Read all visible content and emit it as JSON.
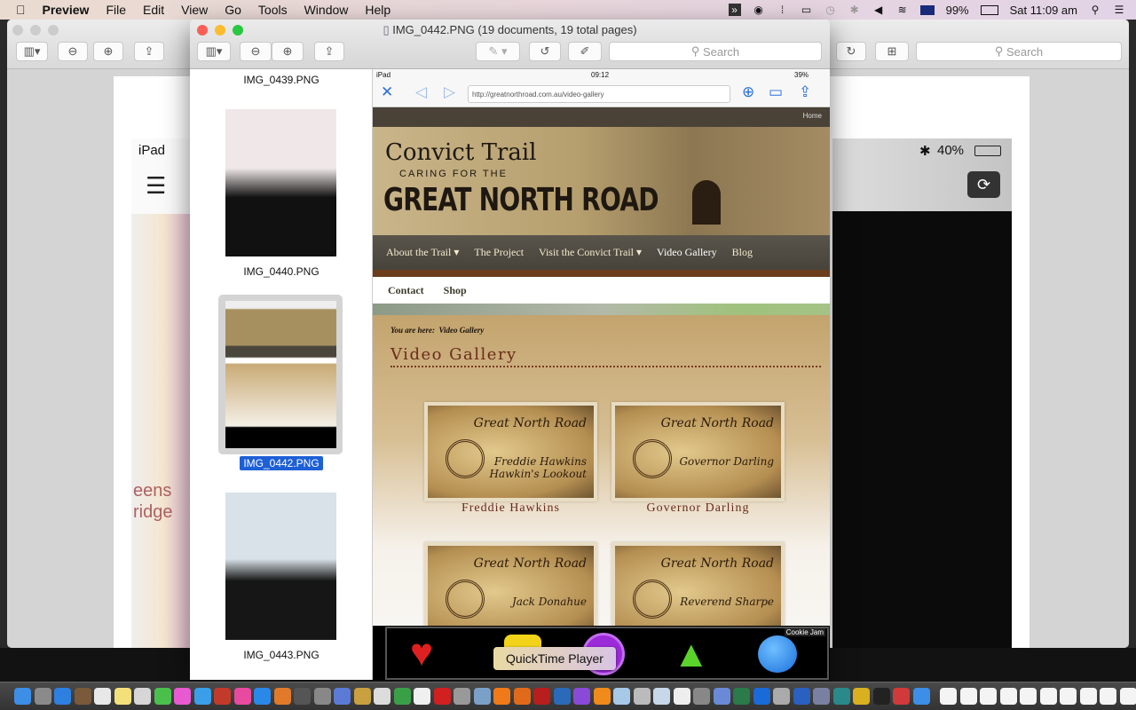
{
  "menubar": {
    "app": "Preview",
    "items": [
      "File",
      "Edit",
      "View",
      "Go",
      "Tools",
      "Window",
      "Help"
    ],
    "battery": "99%",
    "clock": "Sat 11:09 am"
  },
  "background_window": {
    "search_placeholder": "Search",
    "ipad_label": "iPad",
    "battery": "40%",
    "partial_text": "eens\nridge"
  },
  "window": {
    "title": "IMG_0442.PNG (19 documents, 19 total pages)",
    "search_placeholder": "Search",
    "sidebar": [
      {
        "label": "IMG_0439.PNG",
        "selected": false
      },
      {
        "label": "IMG_0440.PNG",
        "selected": false
      },
      {
        "label": "IMG_0442.PNG",
        "selected": true
      },
      {
        "label": "IMG_0443.PNG",
        "selected": false
      }
    ],
    "selection_color": "#1d5fd6"
  },
  "ipad": {
    "status_left": "iPad",
    "time": "09:12",
    "battery": "39%",
    "url": "http://greatnorthroad.com.au/video-gallery",
    "home_link": "Home",
    "logo": {
      "line1": "Convict Trail",
      "line2": "CARING FOR THE",
      "line3": "GREAT NORTH ROAD"
    },
    "nav": [
      "About the Trail",
      "The Project",
      "Visit the Convict Trail",
      "Video Gallery",
      "Blog"
    ],
    "nav2": [
      "Contact",
      "Shop"
    ],
    "breadcrumb_prefix": "You are here:",
    "breadcrumb_current": "Video Gallery",
    "page_title": "Video Gallery",
    "videos": [
      {
        "caption": "Freddie Hawkins",
        "card_title": "Great North Road",
        "card_sub": "Freddie Hawkins Hawkin's Lookout"
      },
      {
        "caption": "Governor Darling",
        "card_title": "Great North Road",
        "card_sub": "Governor Darling"
      },
      {
        "caption": "",
        "card_title": "Great North Road",
        "card_sub": "Jack Donahue"
      },
      {
        "caption": "",
        "card_title": "Great North Road",
        "card_sub": "Reverend Sharpe"
      }
    ],
    "ad_label": "Cookie Jam"
  },
  "tooltip": "QuickTime Player",
  "dock_icons": [
    "finder",
    "launchpad",
    "safari",
    "preview",
    "contacts",
    "calendar",
    "notes",
    "photos",
    "messages",
    "photo-booth",
    "facetime",
    "mission-control",
    "itunes",
    "app-store",
    "ibooks",
    "system-preferences",
    "terminal-script",
    "filezilla-like",
    "utility",
    "gimp",
    "chrome",
    "textedit",
    "opera",
    "pages",
    "image-capture",
    "vlc-like",
    "firefox",
    "filezilla",
    "screens",
    "imovie",
    "vlc",
    "preview-file",
    "unknown",
    "app",
    "unknown",
    "maps",
    "php",
    "android-studio",
    "xcode",
    "app",
    "visual-studio-code",
    "books",
    "globe",
    "cursor",
    "terminal",
    "color-picker",
    "window1",
    "window2",
    "window3",
    "window4",
    "window5",
    "window6",
    "window7",
    "window8",
    "window9",
    "window10",
    "window11",
    "trash"
  ]
}
